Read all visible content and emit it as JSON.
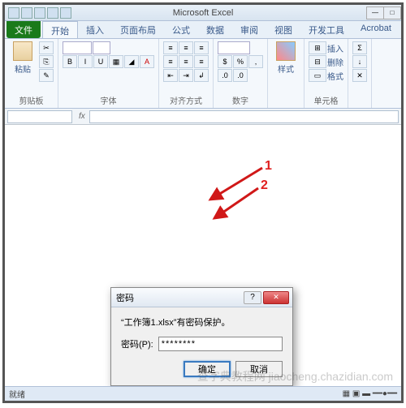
{
  "window": {
    "title": "Microsoft Excel"
  },
  "tabs": {
    "file": "文件",
    "items": [
      "开始",
      "插入",
      "页面布局",
      "公式",
      "数据",
      "审阅",
      "视图",
      "开发工具",
      "Acrobat"
    ],
    "active_index": 0
  },
  "ribbon": {
    "clipboard": {
      "paste": "粘贴",
      "label": "剪贴板"
    },
    "font": {
      "label": "字体",
      "bold": "B",
      "italic": "I",
      "underline": "U"
    },
    "align": {
      "label": "对齐方式"
    },
    "number": {
      "label": "数字",
      "percent": "%"
    },
    "styles": {
      "label": "样式"
    },
    "cells": {
      "insert": "插入",
      "delete": "删除",
      "format": "格式",
      "label": "单元格"
    },
    "editing": {
      "sigma": "Σ"
    }
  },
  "formula_bar": {
    "fx": "fx"
  },
  "dialog": {
    "title": "密码",
    "message": "“工作簿1.xlsx”有密码保护。",
    "password_label": "密码(P):",
    "password_value": "********",
    "ok": "确定",
    "cancel": "取消"
  },
  "annotations": {
    "one": "1",
    "two": "2"
  },
  "status": {
    "ready": "就绪"
  },
  "watermark": "查字典教程网 jiaocheng.chazidian.com"
}
